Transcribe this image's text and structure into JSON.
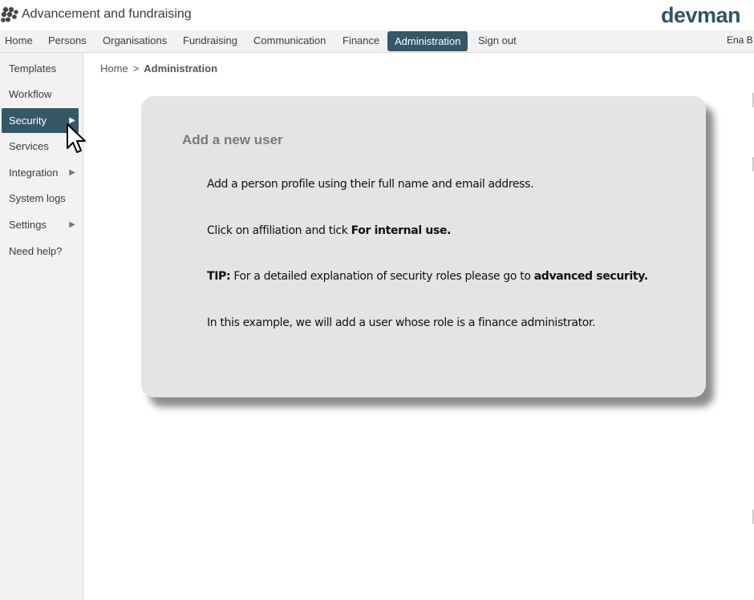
{
  "header": {
    "app_title": "Advancement and fundraising",
    "brand": "devman"
  },
  "nav": {
    "items": [
      {
        "label": "Home"
      },
      {
        "label": "Persons"
      },
      {
        "label": "Organisations"
      },
      {
        "label": "Fundraising"
      },
      {
        "label": "Communication"
      },
      {
        "label": "Finance"
      },
      {
        "label": "Administration",
        "active": true
      },
      {
        "label": "Sign out"
      }
    ],
    "user": "Ena B"
  },
  "sidebar": {
    "items": [
      {
        "label": "Templates",
        "has_submenu": false
      },
      {
        "label": "Workflow",
        "has_submenu": false
      },
      {
        "label": "Security",
        "has_submenu": true,
        "active": true
      },
      {
        "label": "Services",
        "has_submenu": false
      },
      {
        "label": "Integration",
        "has_submenu": true
      },
      {
        "label": "System logs",
        "has_submenu": false
      },
      {
        "label": "Settings",
        "has_submenu": true
      },
      {
        "label": "Need help?",
        "has_submenu": false
      }
    ],
    "arrow_glyph": "▶"
  },
  "breadcrumb": {
    "home": "Home",
    "separator": ">",
    "current": "Administration"
  },
  "tour_card": {
    "title": "Add a new user",
    "line1": "Add a person profile using their full name and email address.",
    "line2_prefix": "Click on affiliation and tick ",
    "line2_bold": "For internal use.",
    "line3_bold_prefix": "TIP:",
    "line3_middle": " For a detailed explanation of security roles please go to ",
    "line3_bold_suffix": "advanced security.",
    "line4": "In this example, we will add a user whose role is a finance administrator."
  },
  "colors": {
    "accent": "#345868",
    "brand": "#2f5466",
    "sidebar_bg": "#f2f2f2",
    "card_bg": "#e4e4e4"
  },
  "icons": {
    "app_logo": "cluster-dots-icon",
    "cursor": "mouse-pointer-icon"
  }
}
